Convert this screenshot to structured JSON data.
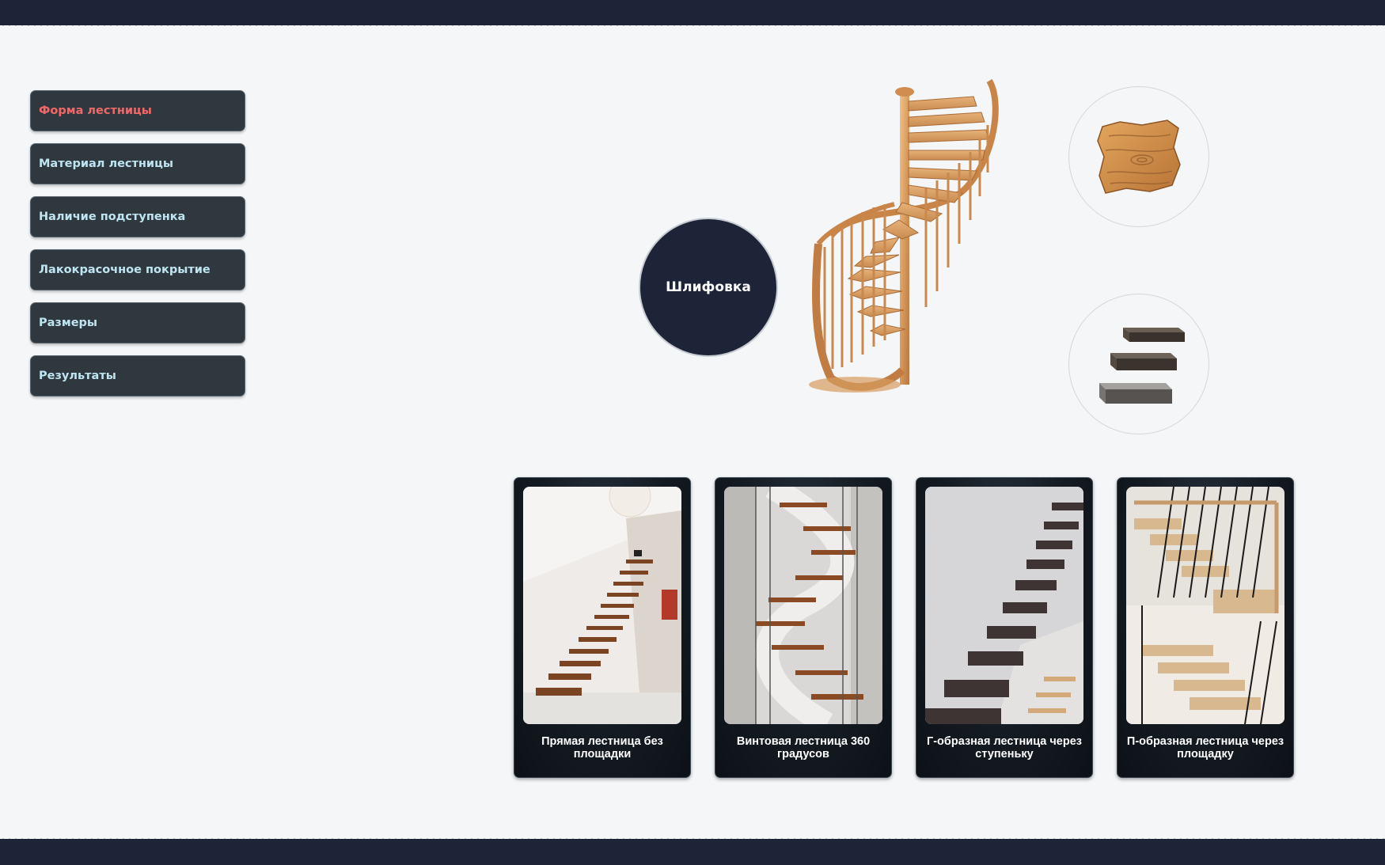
{
  "menu": {
    "items": [
      {
        "label": "Форма лестницы",
        "active": true
      },
      {
        "label": "Материал лестницы",
        "active": false
      },
      {
        "label": "Наличие подступенка",
        "active": false
      },
      {
        "label": "Лакокрасочное покрытие",
        "active": false
      },
      {
        "label": "Размеры",
        "active": false
      },
      {
        "label": "Результаты",
        "active": false
      }
    ]
  },
  "hub": {
    "label": "Шлифовка"
  },
  "cards": [
    {
      "title": "Прямая лестница без площадки",
      "icon": "floating-straight-stair-photo"
    },
    {
      "title": "Винтовая лестница 360 градусов",
      "icon": "spiral-stair-photo"
    },
    {
      "title": "Г-образная лестница через ступеньку",
      "icon": "l-shaped-stair-photo"
    },
    {
      "title": "П-образная лестница через площадку",
      "icon": "u-shaped-stair-photo"
    }
  ],
  "colors": {
    "band": "#1e2438",
    "menu_bg": "#2f383e",
    "menu_text": "#bfe4f2",
    "menu_active_text": "#f26868",
    "background": "#f4f6f8"
  }
}
